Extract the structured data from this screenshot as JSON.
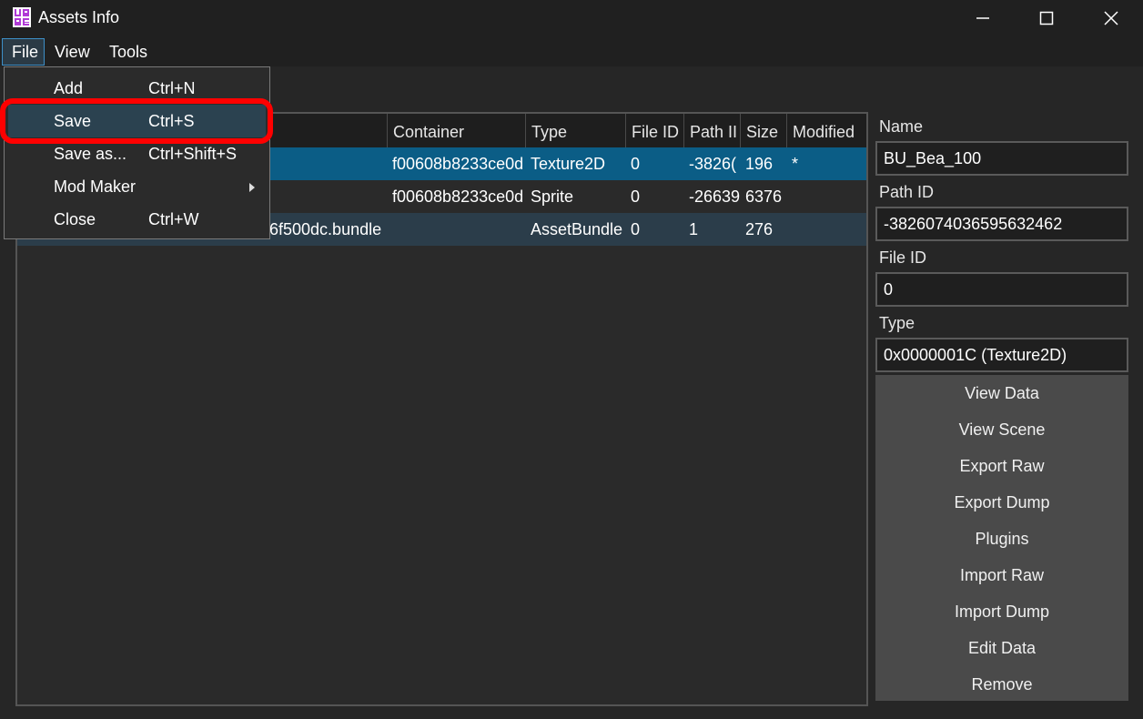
{
  "window": {
    "title": "Assets Info"
  },
  "menubar": {
    "file": "File",
    "view": "View",
    "tools": "Tools"
  },
  "file_menu": {
    "items": [
      {
        "label": "Add",
        "shortcut": "Ctrl+N"
      },
      {
        "label": "Save",
        "shortcut": "Ctrl+S"
      },
      {
        "label": "Save as...",
        "shortcut": "Ctrl+Shift+S"
      },
      {
        "label": "Mod Maker",
        "shortcut": ""
      },
      {
        "label": "Close",
        "shortcut": "Ctrl+W"
      }
    ]
  },
  "table": {
    "headers": [
      "Container",
      "Type",
      "File ID",
      "Path II",
      "Size",
      "Modified"
    ],
    "rows": [
      {
        "name": "",
        "container": "f00608b8233ce0d",
        "type": "Texture2D",
        "file_id": "0",
        "path_id": "-3826(",
        "size": "196",
        "modified": "*"
      },
      {
        "name": "",
        "container": "f00608b8233ce0d",
        "type": "Sprite",
        "file_id": "0",
        "path_id": "-26639",
        "size": "6376",
        "modified": ""
      },
      {
        "name": "6f500dc.bundle",
        "container": "",
        "type": "AssetBundle",
        "file_id": "0",
        "path_id": "1",
        "size": "276",
        "modified": ""
      }
    ]
  },
  "details": {
    "name_label": "Name",
    "name_value": "BU_Bea_100",
    "path_id_label": "Path ID",
    "path_id_value": "-3826074036595632462",
    "file_id_label": "File ID",
    "file_id_value": "0",
    "type_label": "Type",
    "type_value": "0x0000001C (Texture2D)"
  },
  "buttons": [
    "View Data",
    "View Scene",
    "Export Raw",
    "Export Dump",
    "Plugins",
    "Import Raw",
    "Import Dump",
    "Edit Data",
    "Remove"
  ],
  "colors": {
    "selected_row": "#0b5d86",
    "highlight_ring": "#ff0000",
    "menu_hover": "#2b4250"
  }
}
